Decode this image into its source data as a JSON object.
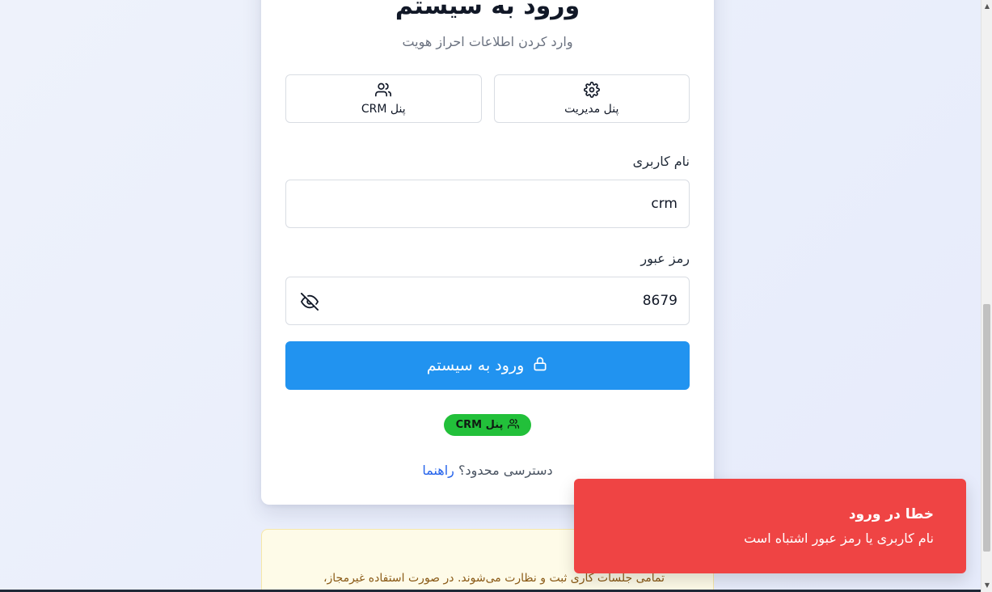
{
  "login": {
    "title": "ورود به سیستم",
    "subtitle": "وارد کردن اطلاعات احراز هویت",
    "tabs": [
      {
        "label": "پنل مدیریت",
        "icon": "gear-icon"
      },
      {
        "label": "پنل CRM",
        "icon": "users-icon"
      }
    ],
    "username": {
      "label": "نام کاربری",
      "value": "crm"
    },
    "password": {
      "label": "رمز عبور",
      "value": "8679"
    },
    "submit_label": "ورود به سیستم",
    "active_panel_badge": "پنل CRM",
    "help_text": "دسترسی محدود؟",
    "help_link": "راهنما"
  },
  "warning": {
    "text": "تمامی جلسات کاری ثبت و نظارت می‌شوند. در صورت استفاده غیرمجاز،"
  },
  "toast": {
    "title": "خطا در ورود",
    "message": "نام کاربری یا رمز عبور اشتباه است"
  },
  "colors": {
    "primary": "#2193f0",
    "badge": "#22c03a",
    "toast": "#ef4444",
    "link": "#2563eb"
  }
}
